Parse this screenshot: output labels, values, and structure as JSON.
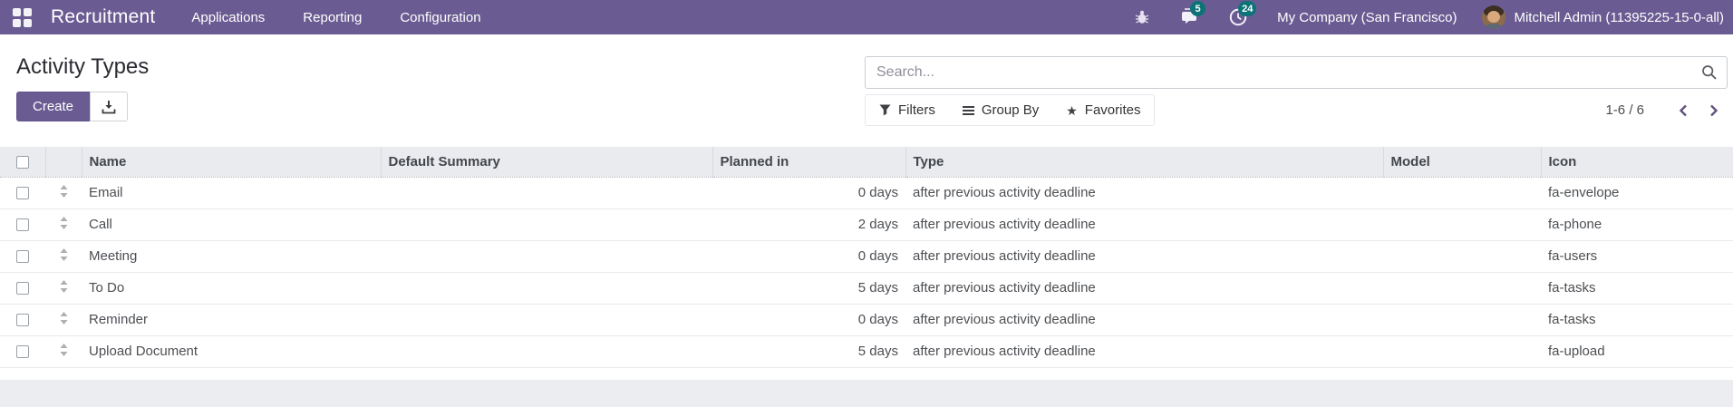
{
  "nav": {
    "app_name": "Recruitment",
    "menus": [
      "Applications",
      "Reporting",
      "Configuration"
    ],
    "messages_badge": "5",
    "activities_badge": "24",
    "company": "My Company (San Francisco)",
    "user": "Mitchell Admin (11395225-15-0-all)"
  },
  "controls": {
    "title": "Activity Types",
    "create_label": "Create",
    "search_placeholder": "Search...",
    "filters_label": "Filters",
    "group_by_label": "Group By",
    "favorites_label": "Favorites",
    "favorites_glyph": "★",
    "pager": "1-6 / 6"
  },
  "table": {
    "columns": [
      "Name",
      "Default Summary",
      "Planned in",
      "Type",
      "Model",
      "Icon"
    ],
    "rows": [
      {
        "name": "Email",
        "planned": "0 days",
        "type": "after previous activity deadline",
        "icon": "fa-envelope"
      },
      {
        "name": "Call",
        "planned": "2 days",
        "type": "after previous activity deadline",
        "icon": "fa-phone"
      },
      {
        "name": "Meeting",
        "planned": "0 days",
        "type": "after previous activity deadline",
        "icon": "fa-users"
      },
      {
        "name": "To Do",
        "planned": "5 days",
        "type": "after previous activity deadline",
        "icon": "fa-tasks"
      },
      {
        "name": "Reminder",
        "planned": "0 days",
        "type": "after previous activity deadline",
        "icon": "fa-tasks"
      },
      {
        "name": "Upload Document",
        "planned": "5 days",
        "type": "after previous activity deadline",
        "icon": "fa-upload"
      }
    ]
  },
  "icons": {
    "apps_menu": "grid-2x2",
    "debug": "bug",
    "messages": "chat-bubbles",
    "activities": "clock",
    "export": "download-tray",
    "search": "magnifier",
    "filters": "funnel",
    "group_by": "stacked-lines",
    "favorites": "star",
    "pager_previous": "chevron-left",
    "pager_next": "chevron-right",
    "row_handle": "sort-arrows"
  },
  "colors": {
    "navbar_bg": "#6a5c92",
    "badge_bg": "#0d7377",
    "primary_button_bg": "#6a5c92",
    "header_row_bg": "#e9ebef",
    "chevron": "#60527f"
  }
}
